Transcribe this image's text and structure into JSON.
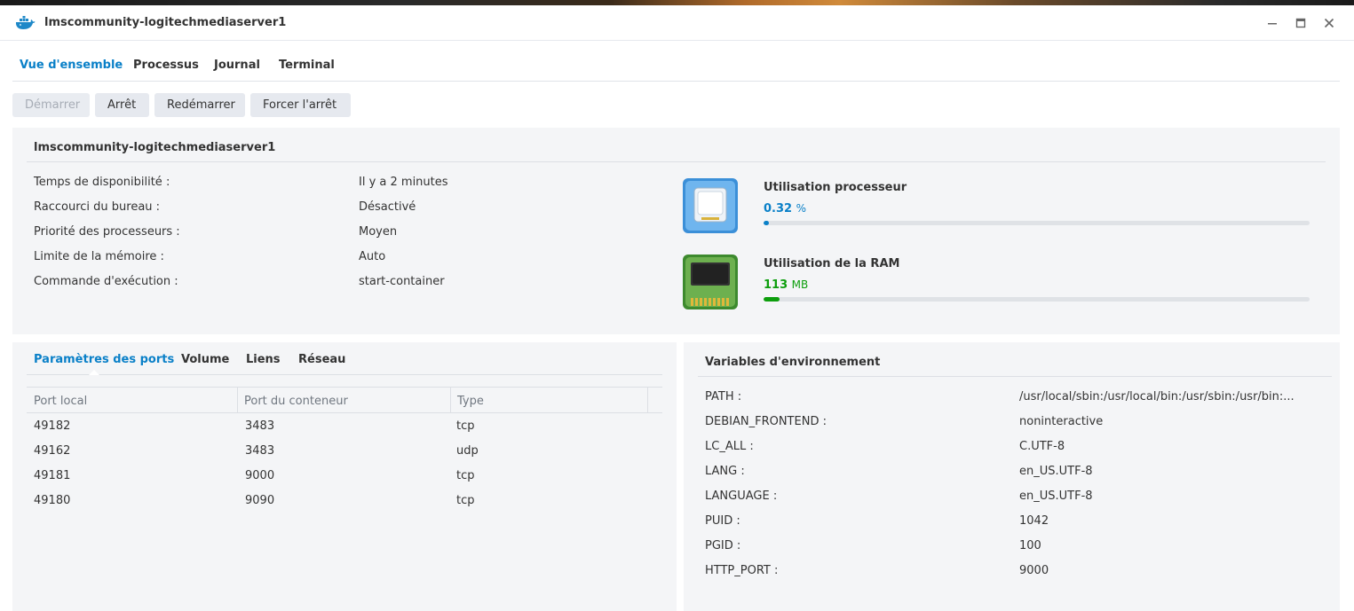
{
  "window": {
    "title": "lmscommunity-logitechmediaserver1"
  },
  "tabs": [
    {
      "label": "Vue d'ensemble",
      "active": true
    },
    {
      "label": "Processus",
      "active": false
    },
    {
      "label": "Journal",
      "active": false
    },
    {
      "label": "Terminal",
      "active": false
    }
  ],
  "toolbar": {
    "start_label": "Démarrer",
    "stop_label": "Arrêt",
    "restart_label": "Redémarrer",
    "force_stop_label": "Forcer l'arrêt"
  },
  "overview": {
    "container_name": "lmscommunity-logitechmediaserver1",
    "info": [
      {
        "label": "Temps de disponibilité :",
        "value": "Il y a 2 minutes"
      },
      {
        "label": "Raccourci du bureau :",
        "value": "Désactivé"
      },
      {
        "label": "Priorité des processeurs :",
        "value": "Moyen"
      },
      {
        "label": "Limite de la mémoire :",
        "value": "Auto"
      },
      {
        "label": "Commande d'exécution :",
        "value": "start-container"
      }
    ],
    "cpu": {
      "title": "Utilisation processeur",
      "value": "0.32",
      "unit": "%",
      "fraction": 0.0032,
      "color": "#0a80c8"
    },
    "ram": {
      "title": "Utilisation de la RAM",
      "value": "113",
      "unit": "MB",
      "fraction": 0.03,
      "color": "#0d9e0d"
    }
  },
  "ports_panel": {
    "tabs": [
      {
        "label": "Paramètres des ports",
        "active": true
      },
      {
        "label": "Volume",
        "active": false
      },
      {
        "label": "Liens",
        "active": false
      },
      {
        "label": "Réseau",
        "active": false
      }
    ],
    "columns": [
      "Port local",
      "Port du conteneur",
      "Type"
    ],
    "rows": [
      [
        "49182",
        "3483",
        "tcp"
      ],
      [
        "49162",
        "3483",
        "udp"
      ],
      [
        "49181",
        "9000",
        "tcp"
      ],
      [
        "49180",
        "9090",
        "tcp"
      ]
    ]
  },
  "env_panel": {
    "title": "Variables d'environnement",
    "vars": [
      {
        "key": "PATH :",
        "value": "/usr/local/sbin:/usr/local/bin:/usr/sbin:/usr/bin:..."
      },
      {
        "key": "DEBIAN_FRONTEND :",
        "value": "noninteractive"
      },
      {
        "key": "LC_ALL :",
        "value": "C.UTF-8"
      },
      {
        "key": "LANG :",
        "value": "en_US.UTF-8"
      },
      {
        "key": "LANGUAGE :",
        "value": "en_US.UTF-8"
      },
      {
        "key": "PUID :",
        "value": "1042"
      },
      {
        "key": "PGID :",
        "value": "100"
      },
      {
        "key": "HTTP_PORT :",
        "value": "9000"
      }
    ]
  }
}
